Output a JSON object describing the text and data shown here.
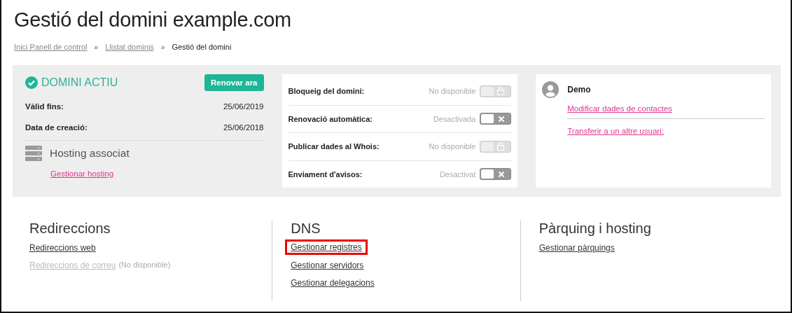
{
  "title": "Gestió del domini example.com",
  "breadcrumb": [
    {
      "label": "Inici Panell de control",
      "link": true
    },
    {
      "separator": "»",
      "label": "Llistat dominis",
      "link": true
    },
    {
      "separator": "»",
      "label": "Gestió del domini",
      "link": false
    }
  ],
  "status": {
    "label": "DOMINI ACTIU",
    "button": "Renovar ara",
    "fields": [
      {
        "label": "Vàlid fins:",
        "value": "25/06/2019"
      },
      {
        "label": "Data de creació:",
        "value": "25/06/2018"
      }
    ],
    "hosting": {
      "title": "Hosting associat",
      "link": "Gestionar hosting"
    }
  },
  "settings": [
    {
      "label": "Bloqueig del domini:",
      "status": "No disponible",
      "kind": "locked",
      "on": false
    },
    {
      "label": "Renovació automàtica:",
      "status": "Desactivada",
      "kind": "switch",
      "on": false
    },
    {
      "label": "Publicar dades al Whois:",
      "status": "No disponible",
      "kind": "locked",
      "on": false
    },
    {
      "label": "Enviament d'avisos:",
      "status": "Desactivat",
      "kind": "switch",
      "on": false
    }
  ],
  "contact": {
    "name": "Demo",
    "links": [
      "Modificar dades de contactes",
      "Transferir a un altre usuari:"
    ]
  },
  "sections": [
    {
      "title": "Redireccions",
      "links": [
        {
          "label": "Redireccions web",
          "disabled": false,
          "highlighted": false
        },
        {
          "label": "Redireccions de correu",
          "disabled": true,
          "note": "(No disponible)"
        }
      ]
    },
    {
      "title": "DNS",
      "links": [
        {
          "label": "Gestionar registres",
          "disabled": false,
          "highlighted": true
        },
        {
          "label": "Gestionar servidors",
          "disabled": false,
          "highlighted": false
        },
        {
          "label": "Gestionar delegacions",
          "disabled": false,
          "highlighted": false
        }
      ]
    },
    {
      "title": "Pàrquing i hosting",
      "links": [
        {
          "label": "Gestionar pàrquings",
          "disabled": false,
          "highlighted": false
        }
      ]
    }
  ]
}
